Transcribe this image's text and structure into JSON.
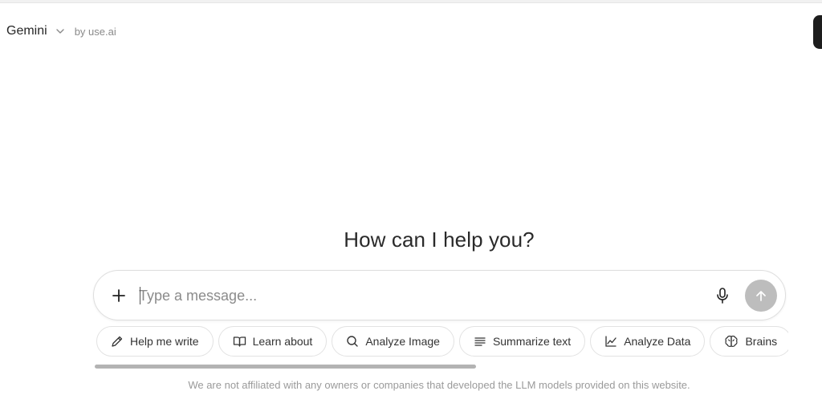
{
  "header": {
    "model_name": "Gemini",
    "provider_text": "by use.ai"
  },
  "main": {
    "headline": "How can I help you?"
  },
  "composer": {
    "placeholder": "Type a message...",
    "value": ""
  },
  "suggestions": [
    {
      "label": "Help me write",
      "icon": "pencil-icon"
    },
    {
      "label": "Learn about",
      "icon": "book-icon"
    },
    {
      "label": "Analyze Image",
      "icon": "search-icon"
    },
    {
      "label": "Summarize text",
      "icon": "lines-icon"
    },
    {
      "label": "Analyze Data",
      "icon": "chart-icon"
    },
    {
      "label": "Brains",
      "icon": "brain-icon"
    }
  ],
  "footer": {
    "disclaimer": "We are not affiliated with any owners or companies that developed the LLM models provided on this website."
  },
  "colors": {
    "send_button": "#bdbdbd",
    "border": "#dedede",
    "muted_text": "#9a9a9a"
  }
}
